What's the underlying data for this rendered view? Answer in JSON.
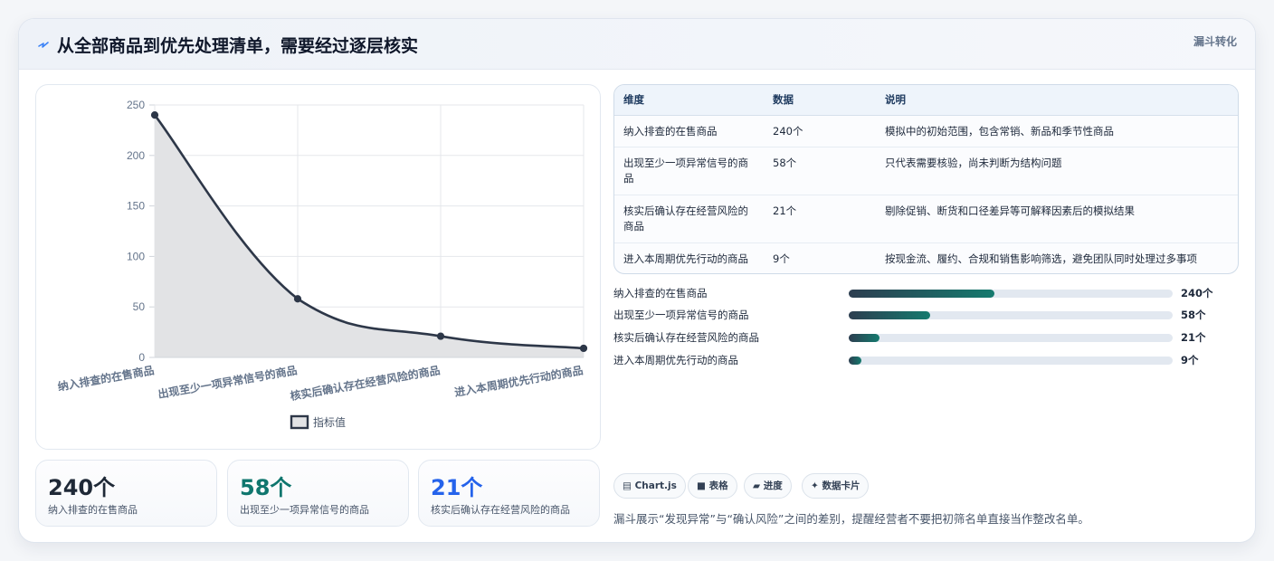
{
  "header": {
    "title": "从全部商品到优先处理清单，需要经过逐层核实",
    "tag": "漏斗转化",
    "icon": "lightning-bolt-icon"
  },
  "chart_data": {
    "type": "area",
    "categories": [
      "纳入排查的在售商品",
      "出现至少一项异常信号的商品",
      "核实后确认存在经营风险的商品",
      "进入本周期优先行动的商品"
    ],
    "series": [
      {
        "name": "指标值",
        "values": [
          240,
          58,
          21,
          9
        ]
      }
    ],
    "yticks": [
      0,
      50,
      100,
      150,
      200,
      250
    ],
    "ylim": [
      0,
      250
    ],
    "grid": true,
    "legend": "bottom",
    "colors": {
      "line": "#2d3748",
      "fill": "#e2e3e5"
    }
  },
  "stats": [
    {
      "value": "240个",
      "label": "纳入排查的在售商品",
      "color": "#1f2937"
    },
    {
      "value": "58个",
      "label": "出现至少一项异常信号的商品",
      "color": "#0f766e"
    },
    {
      "value": "21个",
      "label": "核实后确认存在经营风险的商品",
      "color": "#2563eb"
    }
  ],
  "table": {
    "headers": [
      "维度",
      "数据",
      "说明"
    ],
    "rows": [
      [
        "纳入排查的在售商品",
        "240个",
        "模拟中的初始范围，包含常销、新品和季节性商品"
      ],
      [
        "出现至少一项异常信号的商品",
        "58个",
        "只代表需要核验，尚未判断为结构问题"
      ],
      [
        "核实后确认存在经营风险的商品",
        "21个",
        "剔除促销、断货和口径差异等可解释因素后的模拟结果"
      ],
      [
        "进入本周期优先行动的商品",
        "9个",
        "按现金流、履约、合规和销售影响筛选，避免团队同时处理过多事项"
      ]
    ]
  },
  "progress": [
    {
      "label": "纳入排查的在售商品",
      "value": 240,
      "display": "240个",
      "fraction": 0.45
    },
    {
      "label": "出现至少一项异常信号的商品",
      "value": 58,
      "display": "58个",
      "fraction": 0.25
    },
    {
      "label": "核实后确认存在经营风险的商品",
      "value": 21,
      "display": "21个",
      "fraction": 0.095
    },
    {
      "label": "进入本周期优先行动的商品",
      "value": 9,
      "display": "9个",
      "fraction": 0.04
    }
  ],
  "chips": [
    {
      "icon": "chart-icon",
      "glyph": "▤",
      "label": "Chart.js"
    },
    {
      "icon": "table-icon",
      "glyph": "■",
      "label": "表格"
    },
    {
      "icon": "progress-icon",
      "glyph": "▰",
      "label": "进度"
    },
    {
      "icon": "sparkle-icon",
      "glyph": "✦",
      "label": "数据卡片"
    }
  ],
  "note": "漏斗展示“发现异常”与“确认风险”之间的差别，提醒经营者不要把初筛名单直接当作整改名单。"
}
